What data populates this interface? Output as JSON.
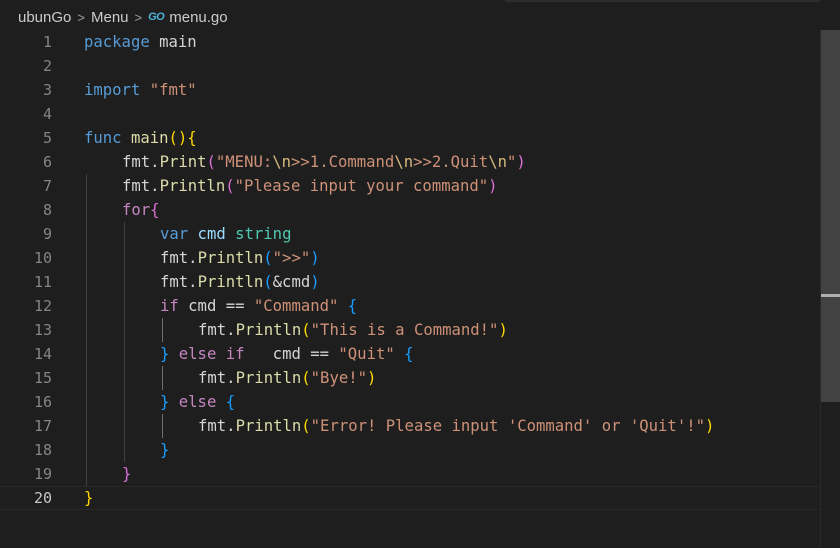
{
  "breadcrumb": {
    "items": [
      "ubunGo",
      "Menu"
    ],
    "separator": ">",
    "file_icon": "GO",
    "file_name": "menu.go"
  },
  "editor": {
    "active_line": 20,
    "line_numbers": [
      "1",
      "2",
      "3",
      "4",
      "5",
      "6",
      "7",
      "8",
      "9",
      "10",
      "11",
      "12",
      "13",
      "14",
      "15",
      "16",
      "17",
      "18",
      "19",
      "20"
    ],
    "tokens": {
      "l1": [
        "package",
        " main"
      ],
      "l3": [
        "import",
        " \"fmt\""
      ],
      "l5": [
        "func",
        " ",
        "main",
        "(",
        ")",
        "{"
      ],
      "l6": [
        "fmt",
        ".",
        "Print",
        "(",
        "\"MENU:",
        "\\n",
        ">>1.Command",
        "\\n",
        ">>2.Quit",
        "\\n",
        "\"",
        ")"
      ],
      "l7": [
        "fmt",
        ".",
        "Println",
        "(",
        "\"Please input your command\"",
        ")"
      ],
      "l8": [
        "for",
        "{"
      ],
      "l9": [
        "var",
        " cmd ",
        "string"
      ],
      "l10": [
        "fmt",
        ".",
        "Println",
        "(",
        "\">>\"",
        ")"
      ],
      "l11": [
        "fmt",
        ".",
        "Println",
        "(",
        "&cmd",
        ")"
      ],
      "l12": [
        "if",
        " cmd == ",
        "\"Command\"",
        " ",
        "{"
      ],
      "l13": [
        "fmt",
        ".",
        "Println",
        "(",
        "\"This is a Command!\"",
        ")"
      ],
      "l14": [
        "}",
        " ",
        "else",
        " ",
        "if",
        "   cmd == ",
        "\"Quit\"",
        " ",
        "{"
      ],
      "l15": [
        "fmt",
        ".",
        "Println",
        "(",
        "\"Bye!\"",
        ")"
      ],
      "l16": [
        "}",
        " ",
        "else",
        " ",
        "{"
      ],
      "l17": [
        "fmt",
        ".",
        "Println",
        "(",
        "\"Error! Please input 'Command' or 'Quit'!\"",
        ")"
      ],
      "l18": [
        "}"
      ],
      "l19": [
        "}"
      ],
      "l20": [
        "}"
      ]
    }
  },
  "colors": {
    "background": "#1e1e1e",
    "keyword": "#569cd6",
    "control": "#c586c0",
    "function": "#dcdcaa",
    "string": "#ce9178",
    "variable": "#9cdcfe",
    "type": "#4ec9b0",
    "bracket_1": "#ffd700",
    "bracket_2": "#da70d6",
    "bracket_3": "#179fff"
  }
}
